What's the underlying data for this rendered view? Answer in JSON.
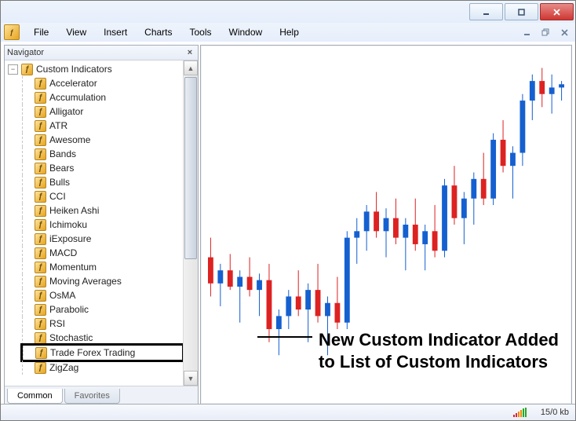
{
  "window": {
    "buttons": {
      "minimize": "minimize",
      "maximize": "maximize",
      "close": "close"
    },
    "mdi_buttons": {
      "minimize": "minimize",
      "restore": "restore",
      "close": "close"
    }
  },
  "menu": {
    "items": [
      "File",
      "View",
      "Insert",
      "Charts",
      "Tools",
      "Window",
      "Help"
    ]
  },
  "navigator": {
    "title": "Navigator",
    "root_label": "Custom Indicators",
    "root_expanded_symbol": "−",
    "items": [
      "Accelerator",
      "Accumulation",
      "Alligator",
      "ATR",
      "Awesome",
      "Bands",
      "Bears",
      "Bulls",
      "CCI",
      "Heiken Ashi",
      "Ichimoku",
      "iExposure",
      "MACD",
      "Momentum",
      "Moving Averages",
      "OsMA",
      "Parabolic",
      "RSI",
      "Stochastic",
      "Trade Forex Trading",
      "ZigZag"
    ],
    "highlight_index": 19,
    "tabs": {
      "common": "Common",
      "favorites": "Favorites"
    }
  },
  "annotation": {
    "line1": "New Custom Indicator Added",
    "line2": "to List of Custom Indicators"
  },
  "status": {
    "transfer": "15/0 kb"
  },
  "chart_data": {
    "type": "candlestick",
    "note": "axis labels not shown in screenshot; values are approximate pixel-derived relative prices on a 0–100 scale",
    "candles": [
      {
        "i": 0,
        "o": 40,
        "h": 46,
        "l": 28,
        "c": 32,
        "color": "down"
      },
      {
        "i": 1,
        "o": 32,
        "h": 38,
        "l": 25,
        "c": 36,
        "color": "up"
      },
      {
        "i": 2,
        "o": 36,
        "h": 41,
        "l": 30,
        "c": 31,
        "color": "down"
      },
      {
        "i": 3,
        "o": 31,
        "h": 36,
        "l": 20,
        "c": 34,
        "color": "up"
      },
      {
        "i": 4,
        "o": 34,
        "h": 40,
        "l": 28,
        "c": 30,
        "color": "down"
      },
      {
        "i": 5,
        "o": 30,
        "h": 35,
        "l": 22,
        "c": 33,
        "color": "up"
      },
      {
        "i": 6,
        "o": 33,
        "h": 38,
        "l": 14,
        "c": 18,
        "color": "down"
      },
      {
        "i": 7,
        "o": 18,
        "h": 24,
        "l": 10,
        "c": 22,
        "color": "up"
      },
      {
        "i": 8,
        "o": 22,
        "h": 30,
        "l": 18,
        "c": 28,
        "color": "up"
      },
      {
        "i": 9,
        "o": 28,
        "h": 36,
        "l": 22,
        "c": 24,
        "color": "down"
      },
      {
        "i": 10,
        "o": 24,
        "h": 32,
        "l": 14,
        "c": 30,
        "color": "up"
      },
      {
        "i": 11,
        "o": 30,
        "h": 38,
        "l": 20,
        "c": 22,
        "color": "down"
      },
      {
        "i": 12,
        "o": 22,
        "h": 28,
        "l": 10,
        "c": 26,
        "color": "up"
      },
      {
        "i": 13,
        "o": 26,
        "h": 34,
        "l": 18,
        "c": 20,
        "color": "down"
      },
      {
        "i": 14,
        "o": 20,
        "h": 48,
        "l": 18,
        "c": 46,
        "color": "up"
      },
      {
        "i": 15,
        "o": 46,
        "h": 52,
        "l": 38,
        "c": 48,
        "color": "up"
      },
      {
        "i": 16,
        "o": 48,
        "h": 56,
        "l": 42,
        "c": 54,
        "color": "up"
      },
      {
        "i": 17,
        "o": 54,
        "h": 60,
        "l": 46,
        "c": 48,
        "color": "down"
      },
      {
        "i": 18,
        "o": 48,
        "h": 55,
        "l": 40,
        "c": 52,
        "color": "up"
      },
      {
        "i": 19,
        "o": 52,
        "h": 58,
        "l": 44,
        "c": 46,
        "color": "down"
      },
      {
        "i": 20,
        "o": 46,
        "h": 52,
        "l": 36,
        "c": 50,
        "color": "up"
      },
      {
        "i": 21,
        "o": 50,
        "h": 58,
        "l": 42,
        "c": 44,
        "color": "down"
      },
      {
        "i": 22,
        "o": 44,
        "h": 50,
        "l": 36,
        "c": 48,
        "color": "up"
      },
      {
        "i": 23,
        "o": 48,
        "h": 56,
        "l": 40,
        "c": 42,
        "color": "down"
      },
      {
        "i": 24,
        "o": 42,
        "h": 64,
        "l": 40,
        "c": 62,
        "color": "up"
      },
      {
        "i": 25,
        "o": 62,
        "h": 68,
        "l": 50,
        "c": 52,
        "color": "down"
      },
      {
        "i": 26,
        "o": 52,
        "h": 60,
        "l": 44,
        "c": 58,
        "color": "up"
      },
      {
        "i": 27,
        "o": 58,
        "h": 66,
        "l": 50,
        "c": 64,
        "color": "up"
      },
      {
        "i": 28,
        "o": 64,
        "h": 72,
        "l": 56,
        "c": 58,
        "color": "down"
      },
      {
        "i": 29,
        "o": 58,
        "h": 78,
        "l": 56,
        "c": 76,
        "color": "up"
      },
      {
        "i": 30,
        "o": 76,
        "h": 82,
        "l": 66,
        "c": 68,
        "color": "down"
      },
      {
        "i": 31,
        "o": 68,
        "h": 74,
        "l": 58,
        "c": 72,
        "color": "up"
      },
      {
        "i": 32,
        "o": 72,
        "h": 90,
        "l": 68,
        "c": 88,
        "color": "up"
      },
      {
        "i": 33,
        "o": 88,
        "h": 96,
        "l": 82,
        "c": 94,
        "color": "up"
      },
      {
        "i": 34,
        "o": 94,
        "h": 98,
        "l": 86,
        "c": 90,
        "color": "down"
      },
      {
        "i": 35,
        "o": 90,
        "h": 96,
        "l": 84,
        "c": 92,
        "color": "up"
      },
      {
        "i": 36,
        "o": 92,
        "h": 94,
        "l": 88,
        "c": 93,
        "color": "up"
      }
    ]
  }
}
